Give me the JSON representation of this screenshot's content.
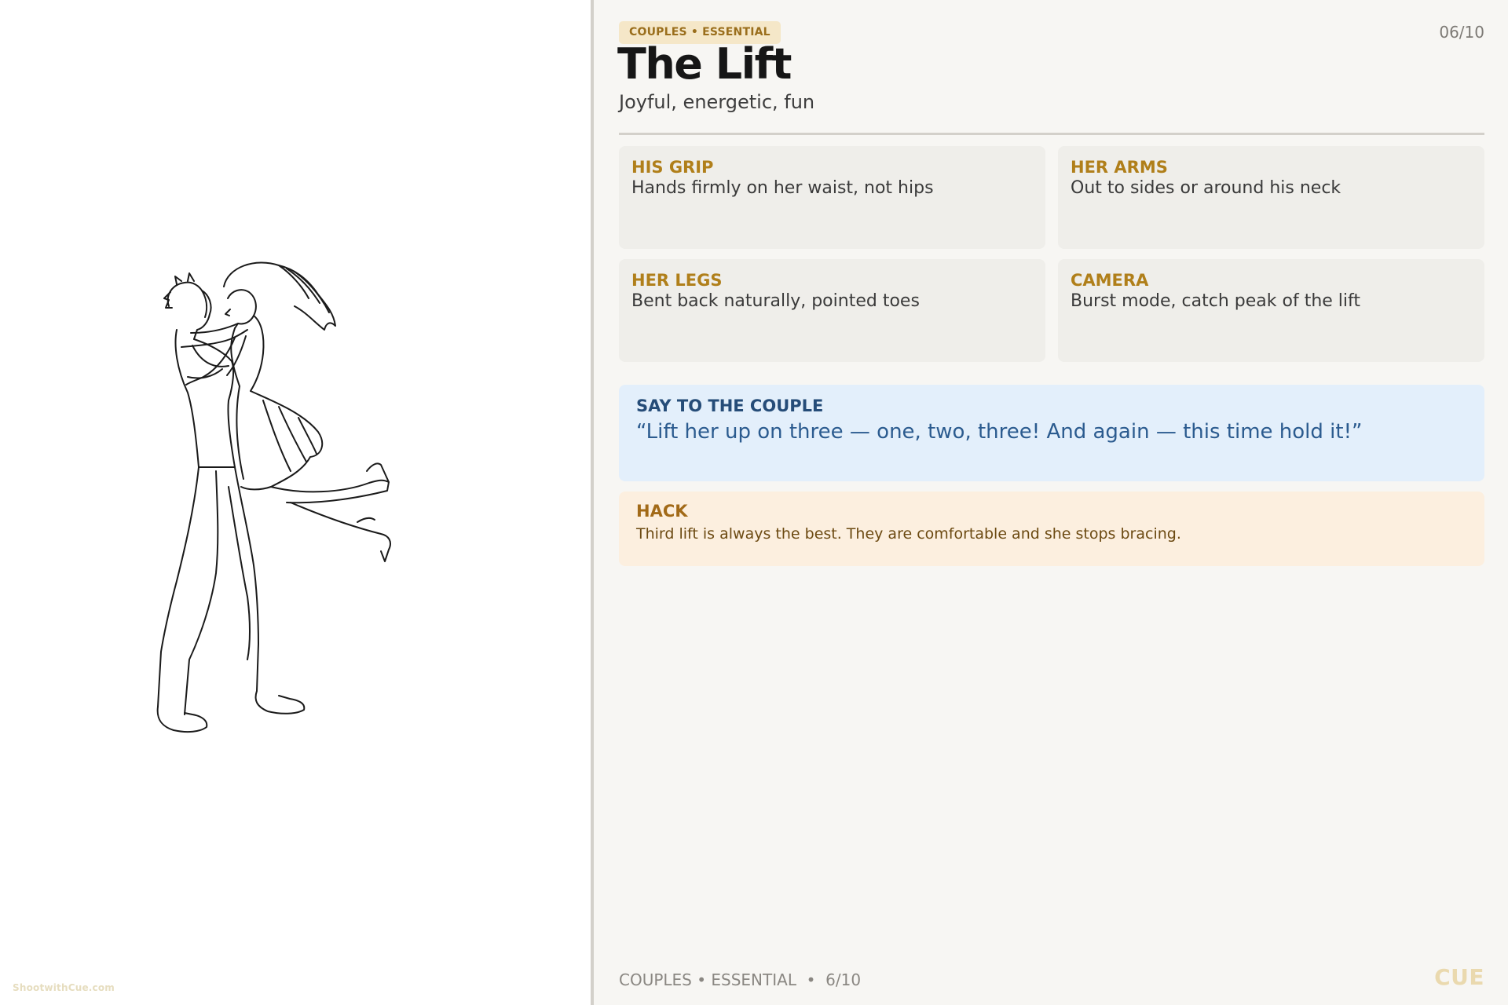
{
  "tag": "COUPLES • ESSENTIAL",
  "counter": "06/10",
  "title": "The Lift",
  "subtitle": "Joyful, energetic, fun",
  "cards": [
    {
      "label": "HIS GRIP",
      "text": "Hands firmly on her waist, not hips"
    },
    {
      "label": "HER ARMS",
      "text": "Out to sides or around his neck"
    },
    {
      "label": "HER LEGS",
      "text": "Bent back naturally, pointed toes"
    },
    {
      "label": "CAMERA",
      "text": "Burst mode, catch peak of the lift"
    }
  ],
  "say": {
    "label": "SAY TO THE COUPLE",
    "text": "“Lift her up on three — one, two, three! And again — this time hold it!”"
  },
  "hack": {
    "label": "HACK",
    "text": "Third lift is always the best. They are comfortable and she stops bracing."
  },
  "footer": "COUPLES • ESSENTIAL  •  6/10",
  "brand": "CUE",
  "watermark": "ShootwithCue.com",
  "illustration": "couple-lift-line-drawing",
  "colors": {
    "accent_gold": "#b07f1a",
    "say_blue": "#2b5b8f",
    "say_bg": "#e3effb",
    "hack_bg": "#fcefdf",
    "panel_bg": "#f7f6f3"
  }
}
